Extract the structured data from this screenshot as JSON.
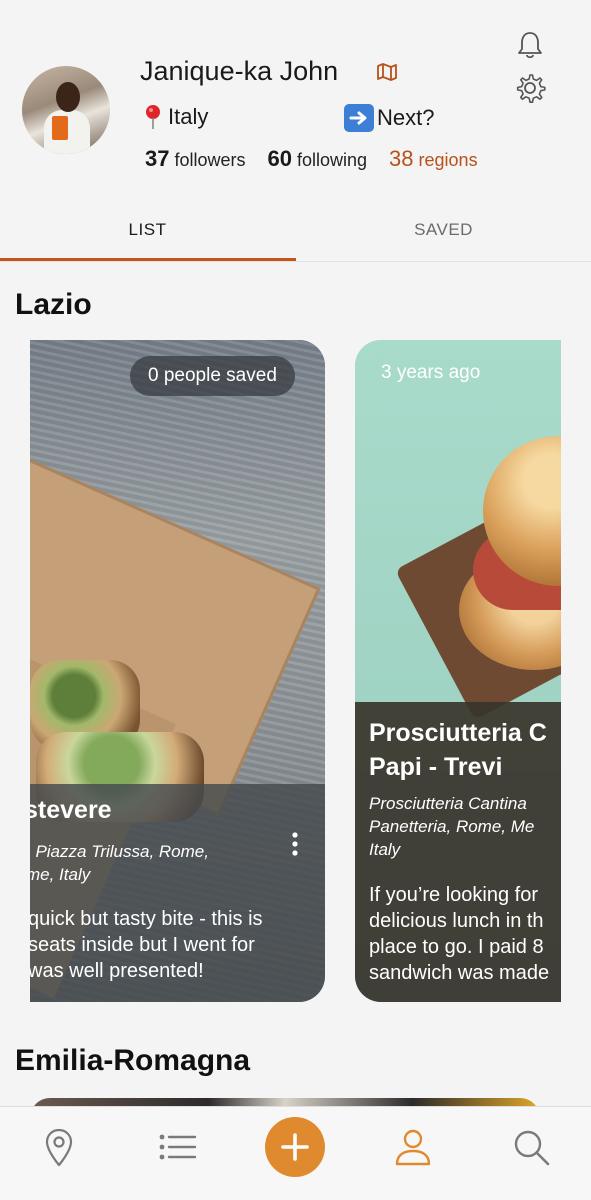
{
  "profile": {
    "name": "Janique-ka John",
    "location": "Italy",
    "next_label": "Next?",
    "stats": {
      "followers_count": "37",
      "followers_label": "followers",
      "following_count": "60",
      "following_label": "following",
      "regions_count": "38",
      "regions_label": "regions"
    }
  },
  "tabs": [
    {
      "label": "LIST",
      "active": true
    },
    {
      "label": "SAVED",
      "active": false
    }
  ],
  "sections": [
    {
      "title": "Lazio",
      "cards": [
        {
          "badge": "0 people saved",
          "title": "stevere",
          "address_lines": [
            ", Piazza Trilussa, Rome,",
            "me, Italy"
          ],
          "description_lines": [
            "quick but tasty bite - this is",
            "seats inside but I went for",
            "was well presented!"
          ]
        },
        {
          "time_ago": "3 years ago",
          "title_lines": [
            "Prosciutteria C",
            "Papi - Trevi"
          ],
          "address_lines": [
            "Prosciutteria Cantina",
            "Panetteria, Rome, Me",
            "Italy"
          ],
          "description_lines": [
            "If you’re looking for",
            "delicious lunch in th",
            "place to go. I paid 8",
            "sandwich was made"
          ]
        }
      ]
    },
    {
      "title": "Emilia-Romagna"
    }
  ],
  "bottom_nav": [
    {
      "icon": "map-pin-icon"
    },
    {
      "icon": "list-icon"
    },
    {
      "icon": "plus-icon"
    },
    {
      "icon": "profile-icon"
    },
    {
      "icon": "search-icon"
    }
  ],
  "colors": {
    "accent": "#c4541c",
    "fab": "#e08a2f",
    "regions": "#b7521a"
  }
}
